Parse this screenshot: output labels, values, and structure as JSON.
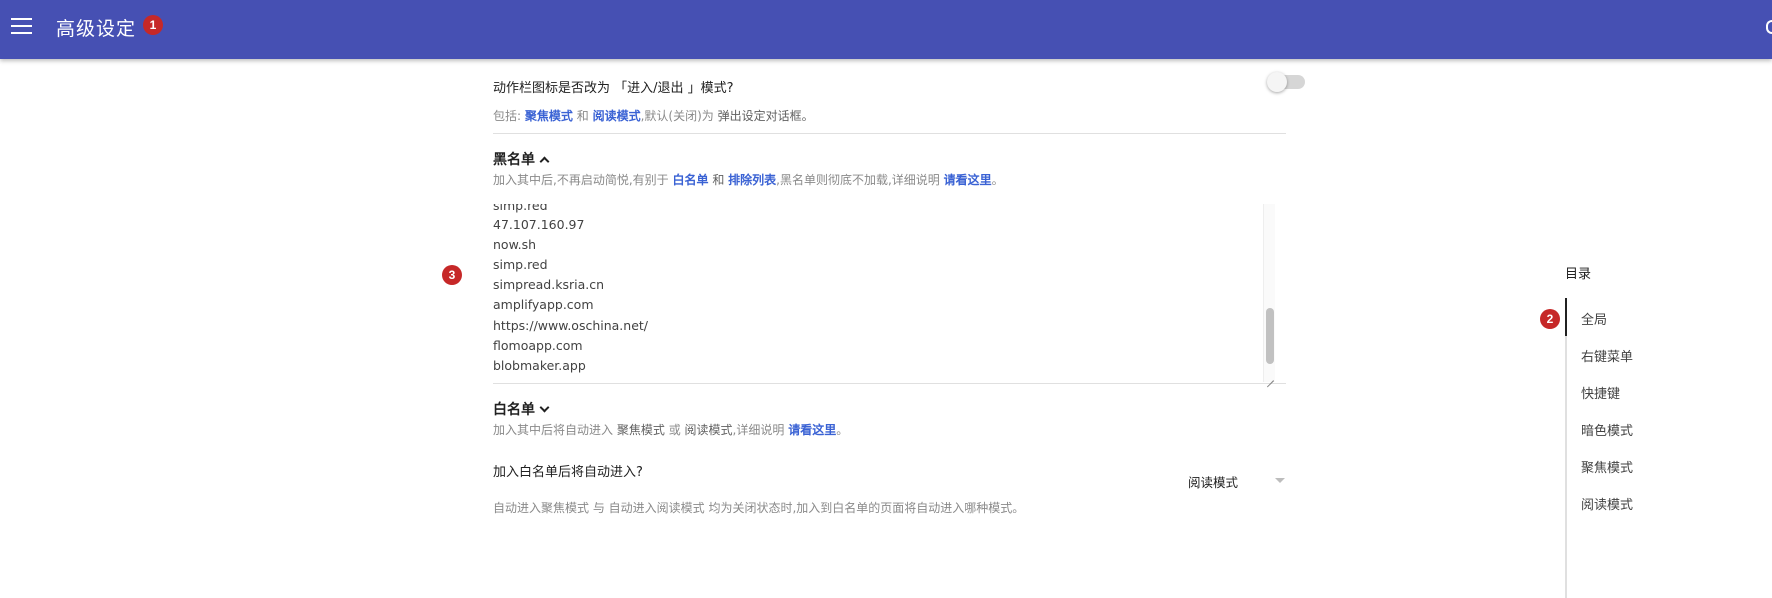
{
  "app_bar": {
    "title": "高级设定",
    "badge": "1"
  },
  "action_bar_setting": {
    "title": "动作栏图标是否改为 「进入/退出 」模式?",
    "desc_prefix": "包括:",
    "link1": "聚焦模式",
    "mid": "和",
    "link2": "阅读模式",
    "desc_suffix": ",默认(关闭)为",
    "desc_end": "弹出设定对话框。",
    "toggle_on": false
  },
  "blacklist": {
    "title": "黑名单",
    "desc_prefix": "加入其中后,不再启动简悦,有别于",
    "link1": "白名单",
    "mid": "和",
    "link2": "排除列表",
    "desc_suffix": ",黑名单则彻底不加载,详细说明",
    "link3": "请看这里",
    "desc_end": "。",
    "badge": "3",
    "entries": [
      "simp.red",
      "47.107.160.97",
      "now.sh",
      "simp.red",
      "simpread.ksria.cn",
      "amplifyapp.com",
      "https://www.oschina.net/",
      "flomoapp.com",
      "blobmaker.app"
    ]
  },
  "whitelist": {
    "title": "白名单",
    "desc_prefix": "加入其中后将自动进入",
    "mode1": "聚焦模式",
    "mid": "或",
    "mode2": "阅读模式",
    "desc_suffix": ",详细说明",
    "link": "请看这里",
    "desc_end": "。"
  },
  "auto_enter": {
    "title": "加入白名单后将自动进入?",
    "selected": "阅读模式",
    "desc_partial": "自动进入聚焦模式 与 自动进入阅读模式 均为关闭状态时,加入到白名单的页面将自动进入哪种模式。"
  },
  "toc": {
    "title": "目录",
    "badge": "2",
    "items": [
      "全局",
      "右键菜单",
      "快捷键",
      "暗色模式",
      "聚焦模式",
      "阅读模式"
    ]
  },
  "colors": {
    "app_bar": "#4650b3",
    "link": "#3a62d4",
    "badge": "#c62828"
  },
  "icons": [
    "menu-icon",
    "chevron-up-icon",
    "chevron-down-icon",
    "dropdown-caret-icon",
    "resize-grip-icon"
  ]
}
